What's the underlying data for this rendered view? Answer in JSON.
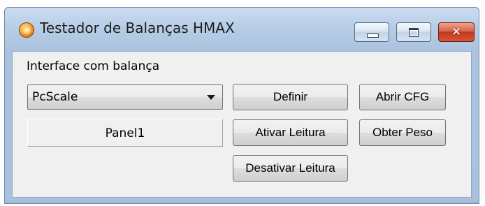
{
  "window": {
    "title": "Testador de Balanças HMAX",
    "icon": "scale-app-icon",
    "controls": {
      "minimize": "minimize-icon",
      "maximize": "maximize-icon",
      "close_label": "✕"
    }
  },
  "form": {
    "interface_label": "Interface com balança",
    "interface_combo": {
      "selected": "PcScale"
    },
    "panel_caption": "Panel1",
    "buttons": {
      "definir": "Definir",
      "abrir_cfg": "Abrir CFG",
      "ativar_leitura": "Ativar Leitura",
      "obter_peso": "Obter Peso",
      "desativar_leitura": "Desativar Leitura"
    }
  },
  "colors": {
    "titlebar": "#b7cde6",
    "client_background": "#f0f0f0",
    "close_button": "#c3391f"
  }
}
